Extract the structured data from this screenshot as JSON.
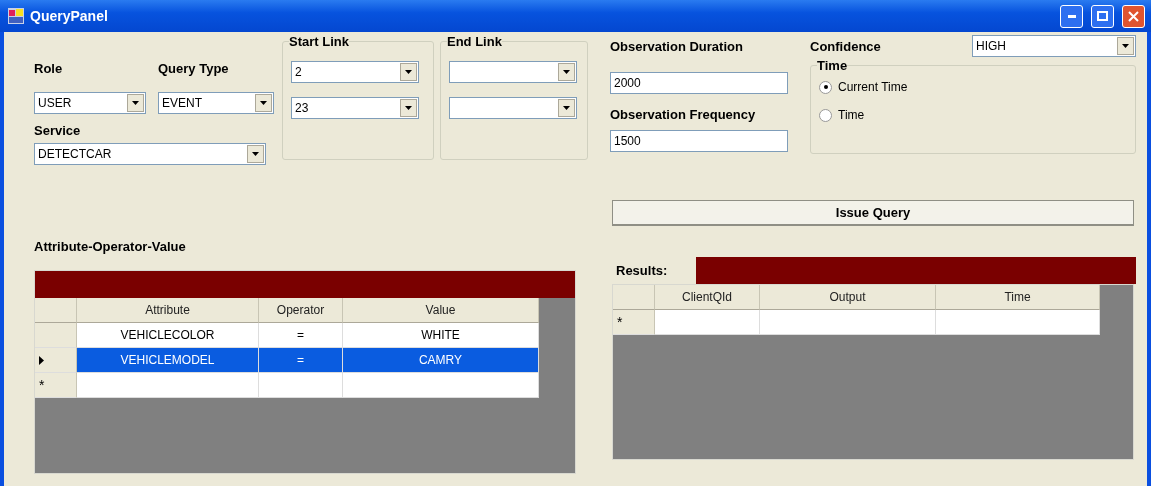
{
  "window": {
    "title": "QueryPanel"
  },
  "role": {
    "label": "Role",
    "value": "USER"
  },
  "query_type": {
    "label": "Query Type",
    "value": "EVENT"
  },
  "service": {
    "label": "Service",
    "value": "DETECTCAR"
  },
  "start_link": {
    "title": "Start Link",
    "combos": [
      {
        "value": "2"
      },
      {
        "value": "23"
      }
    ]
  },
  "end_link": {
    "title": "End Link",
    "combos": [
      {
        "kind": "dropdown"
      },
      {
        "kind": "dropdown"
      }
    ]
  },
  "observation_duration": {
    "label": "Observation Duration",
    "value": "2000"
  },
  "observation_frequency": {
    "label": "Observation Frequency",
    "value": "1500"
  },
  "confidence": {
    "label": "Confidence",
    "value": "HIGH"
  },
  "time_group": {
    "title": "Time",
    "options": [
      {
        "label": "Current Time",
        "selected": true
      },
      {
        "label": "Time",
        "selected": false
      }
    ]
  },
  "issue_button": "Issue Query",
  "aov": {
    "title": "Attribute-Operator-Value",
    "columns": [
      "Attribute",
      "Operator",
      "Value"
    ],
    "rows": [
      {
        "cells": [
          "VEHICLECOLOR",
          "=",
          "WHITE"
        ],
        "selected": false
      },
      {
        "cells": [
          "VEHICLEMODEL",
          "=",
          "CAMRY"
        ],
        "selected": true
      }
    ],
    "new_row_marker": "*"
  },
  "results": {
    "label": "Results:",
    "columns": [
      "ClientQId",
      "Output",
      "Time"
    ],
    "new_row_marker": "*"
  }
}
